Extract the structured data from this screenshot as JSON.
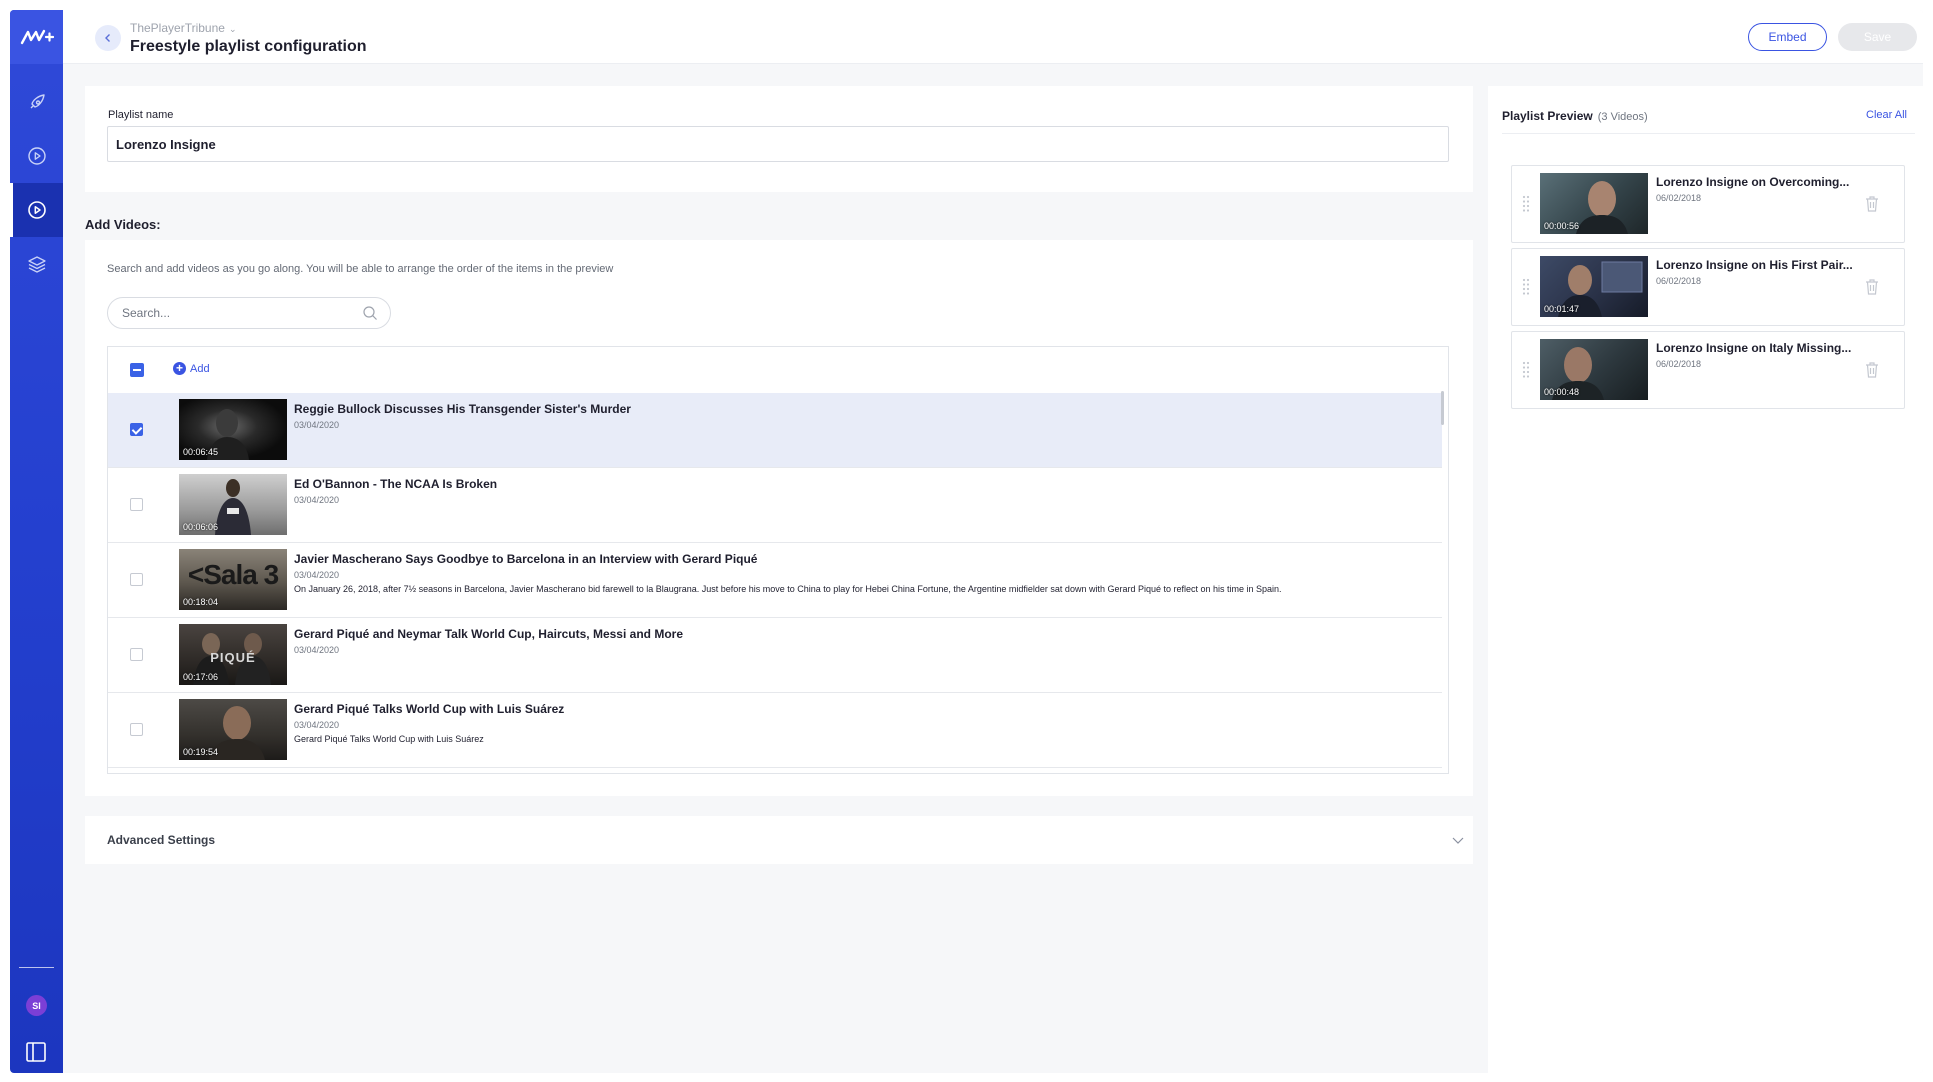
{
  "sidebar": {
    "avatar_initials": "SI",
    "nav_items": [
      {
        "icon": "rocket-icon"
      },
      {
        "icon": "play-circle-icon"
      },
      {
        "icon": "play-circle-icon",
        "active": true
      },
      {
        "icon": "layers-icon"
      }
    ]
  },
  "header": {
    "org_name": "ThePlayerTribune",
    "title": "Freestyle playlist configuration",
    "embed_label": "Embed",
    "save_label": "Save"
  },
  "playlist": {
    "name_label": "Playlist name",
    "name_value": "Lorenzo Insigne"
  },
  "add_videos": {
    "title": "Add Videos:",
    "help": "Search and add videos as you go along. You will be able to arrange the order of the items in the preview",
    "search_placeholder": "Search...",
    "add_label": "Add",
    "videos": [
      {
        "title": "Reggie Bullock Discusses His Transgender Sister's Murder",
        "date": "03/04/2020",
        "duration": "00:06:45",
        "description": "",
        "checked": true
      },
      {
        "title": "Ed O'Bannon - The NCAA Is Broken",
        "date": "03/04/2020",
        "duration": "00:06:06",
        "description": "",
        "checked": false
      },
      {
        "title": "Javier Mascherano Says Goodbye to Barcelona in an Interview with Gerard Piqué",
        "date": "03/04/2020",
        "duration": "00:18:04",
        "description": "On January 26, 2018, after 7½ seasons in Barcelona, Javier Mascherano bid farewell to la Blaugrana. Just before his move to China to play for Hebei China Fortune, the Argentine midfielder sat down with Gerard Piqué to reflect on his time in Spain.",
        "checked": false
      },
      {
        "title": "Gerard Piqué and Neymar Talk World Cup, Haircuts, Messi and More",
        "date": "03/04/2020",
        "duration": "00:17:06",
        "description": "",
        "checked": false
      },
      {
        "title": "Gerard Piqué Talks World Cup with Luis Suárez",
        "date": "03/04/2020",
        "duration": "00:19:54",
        "description": "Gerard Piqué Talks World Cup with Luis Suárez",
        "checked": false
      }
    ],
    "thumb_texts": [
      "",
      "",
      "<Sala 3",
      "PIQUÉ",
      ""
    ]
  },
  "advanced": {
    "label": "Advanced Settings"
  },
  "preview": {
    "title": "Playlist Preview",
    "count": "(3 Videos)",
    "clear_label": "Clear All",
    "items": [
      {
        "title": "Lorenzo Insigne on Overcoming...",
        "date": "06/02/2018",
        "duration": "00:00:56"
      },
      {
        "title": "Lorenzo Insigne on His First Pair...",
        "date": "06/02/2018",
        "duration": "00:01:47"
      },
      {
        "title": "Lorenzo Insigne on Italy Missing...",
        "date": "06/02/2018",
        "duration": "00:00:48"
      }
    ]
  },
  "colors": {
    "accent": "#3a54e2",
    "sidebar": "#2440cf",
    "selected_row": "#e8ecf8",
    "avatar": "#7b3fd6"
  }
}
